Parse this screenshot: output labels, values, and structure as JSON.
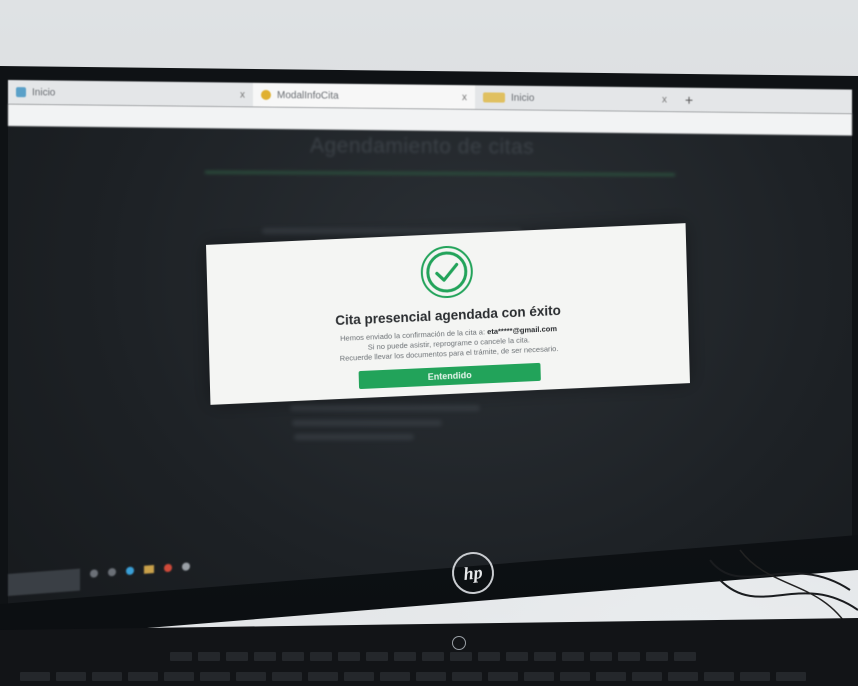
{
  "browser": {
    "tabs": [
      {
        "label": "Inicio",
        "favicon_color": "#5aa0c8",
        "active": false
      },
      {
        "label": "ModalInfoCita",
        "favicon_color": "#e0b030",
        "active": true
      },
      {
        "label": "Inicio",
        "favicon_color": "#e0c060",
        "active": false
      }
    ],
    "close_glyph": "x",
    "new_tab_glyph": "+"
  },
  "page": {
    "title": "Agendamiento de citas"
  },
  "modal": {
    "icon": "check-circle-icon",
    "accent_color": "#22a35a",
    "title": "Cita presencial agendada con éxito",
    "line1_prefix": "Hemos enviado la confirmación de la cita a:",
    "email": "eta*****@gmail.com",
    "line2": "Si no puede asistir, reprograme o cancele la cita.",
    "line3": "Recuerde llevar los documentos para el trámite, de ser necesario.",
    "button_label": "Entendido"
  },
  "monitor": {
    "brand": "hp"
  }
}
